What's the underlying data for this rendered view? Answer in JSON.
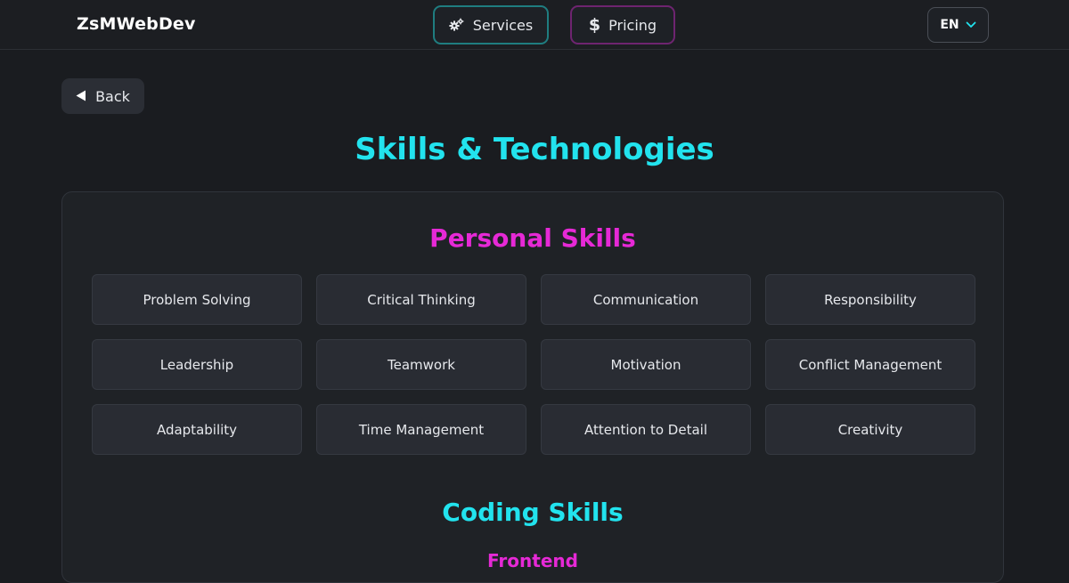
{
  "navbar": {
    "brand": "ZsMWebDev",
    "services_label": "Services",
    "pricing_label": "Pricing",
    "language": "EN"
  },
  "back_label": "Back",
  "page_title": "Skills & Technologies",
  "personal": {
    "title": "Personal Skills",
    "skills": [
      "Problem Solving",
      "Critical Thinking",
      "Communication",
      "Responsibility",
      "Leadership",
      "Teamwork",
      "Motivation",
      "Conflict Management",
      "Adaptability",
      "Time Management",
      "Attention to Detail",
      "Creativity"
    ]
  },
  "coding": {
    "title": "Coding Skills",
    "subtitle": "Frontend"
  },
  "colors": {
    "accent_cyan": "#22e3ee",
    "accent_magenta": "#e629d6",
    "background": "#1a1c20"
  },
  "icons": {
    "services": "gears-icon",
    "pricing": "dollar-icon",
    "language": "chevron-down-icon",
    "back": "triangle-left-icon"
  }
}
